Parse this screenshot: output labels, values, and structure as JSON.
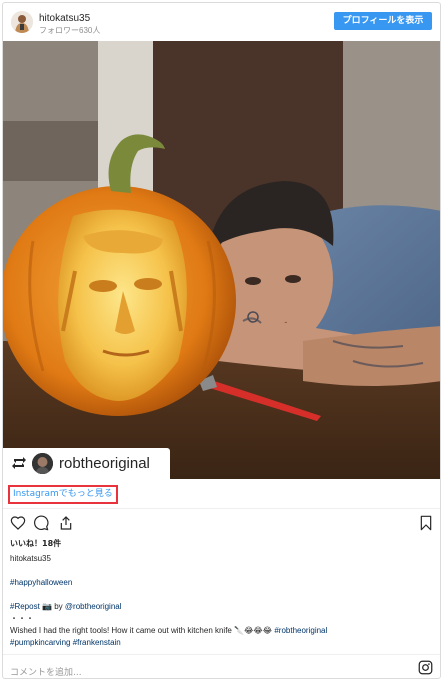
{
  "header": {
    "username": "hitokatsu35",
    "followers": "フォロワー630人",
    "profile_button": "プロフィールを表示"
  },
  "photo": {
    "description_icon": "pumpkin-carving-photo",
    "repost": {
      "icon": "repost-icon",
      "username": "robtheoriginal"
    }
  },
  "more_link": "Instagramでもっと見る",
  "actions": {
    "like_icon": "heart-icon",
    "comment_icon": "comment-icon",
    "share_icon": "share-icon",
    "save_icon": "bookmark-icon"
  },
  "likes": "いいね！18件",
  "caption": {
    "username": "hitokatsu35",
    "line1": "#happyhalloween",
    "line2_prefix": "#Repost ",
    "line2_camera": "📷",
    "line2_by": " by ",
    "line2_mention": "@robtheoriginal",
    "line3": "・・・",
    "line4_text": "Wished I had the right tools! How it came out with kitchen knife 🔪😂😂😂 ",
    "line4_tag": "#robtheoriginal",
    "line5_tag1": "#pumpkincarving",
    "line5_tag2": "#frankenstain"
  },
  "comment_placeholder": "コメントを追加...",
  "colors": {
    "accent": "#3897f0",
    "highlight_border": "#e8323c",
    "hashtag": "#003569"
  }
}
